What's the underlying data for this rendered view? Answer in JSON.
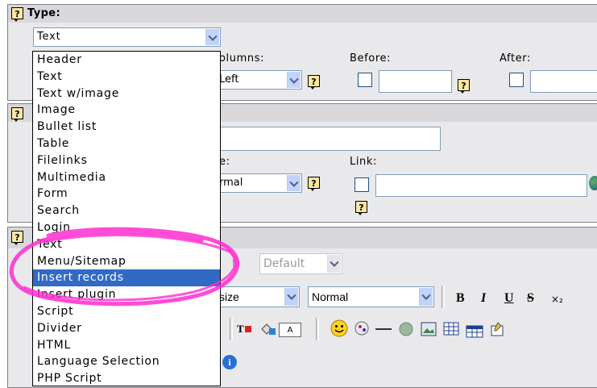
{
  "type_section": {
    "label": "Type:",
    "selected": "Text"
  },
  "type_options": [
    "Header",
    "Text",
    "Text w/image",
    "Image",
    "Bullet list",
    "Table",
    "Filelinks",
    "Multimedia",
    "Form",
    "Search",
    "Login",
    "Text",
    "Menu/Sitemap",
    "Insert records",
    "Insert plugin",
    "Script",
    "Divider",
    "HTML",
    "Language Selection",
    "PHP Script"
  ],
  "row1": {
    "columns_label": "olumns:",
    "columns_value": "Left",
    "before_label": "Before:",
    "after_label": "After:"
  },
  "row2": {
    "style_label": "e:",
    "style_value": "rmal",
    "link_label": "Link:"
  },
  "rte": {
    "format_label": "t:",
    "format_value": "Default",
    "size_value": "size",
    "style_value": "Normal",
    "bold": "B",
    "italic": "I",
    "underline": "U",
    "strike": "S",
    "subscript": "×₂",
    "font_box": "A"
  },
  "colors": {
    "highlight": "#316ac5",
    "annotation": "#ff2ccf"
  }
}
